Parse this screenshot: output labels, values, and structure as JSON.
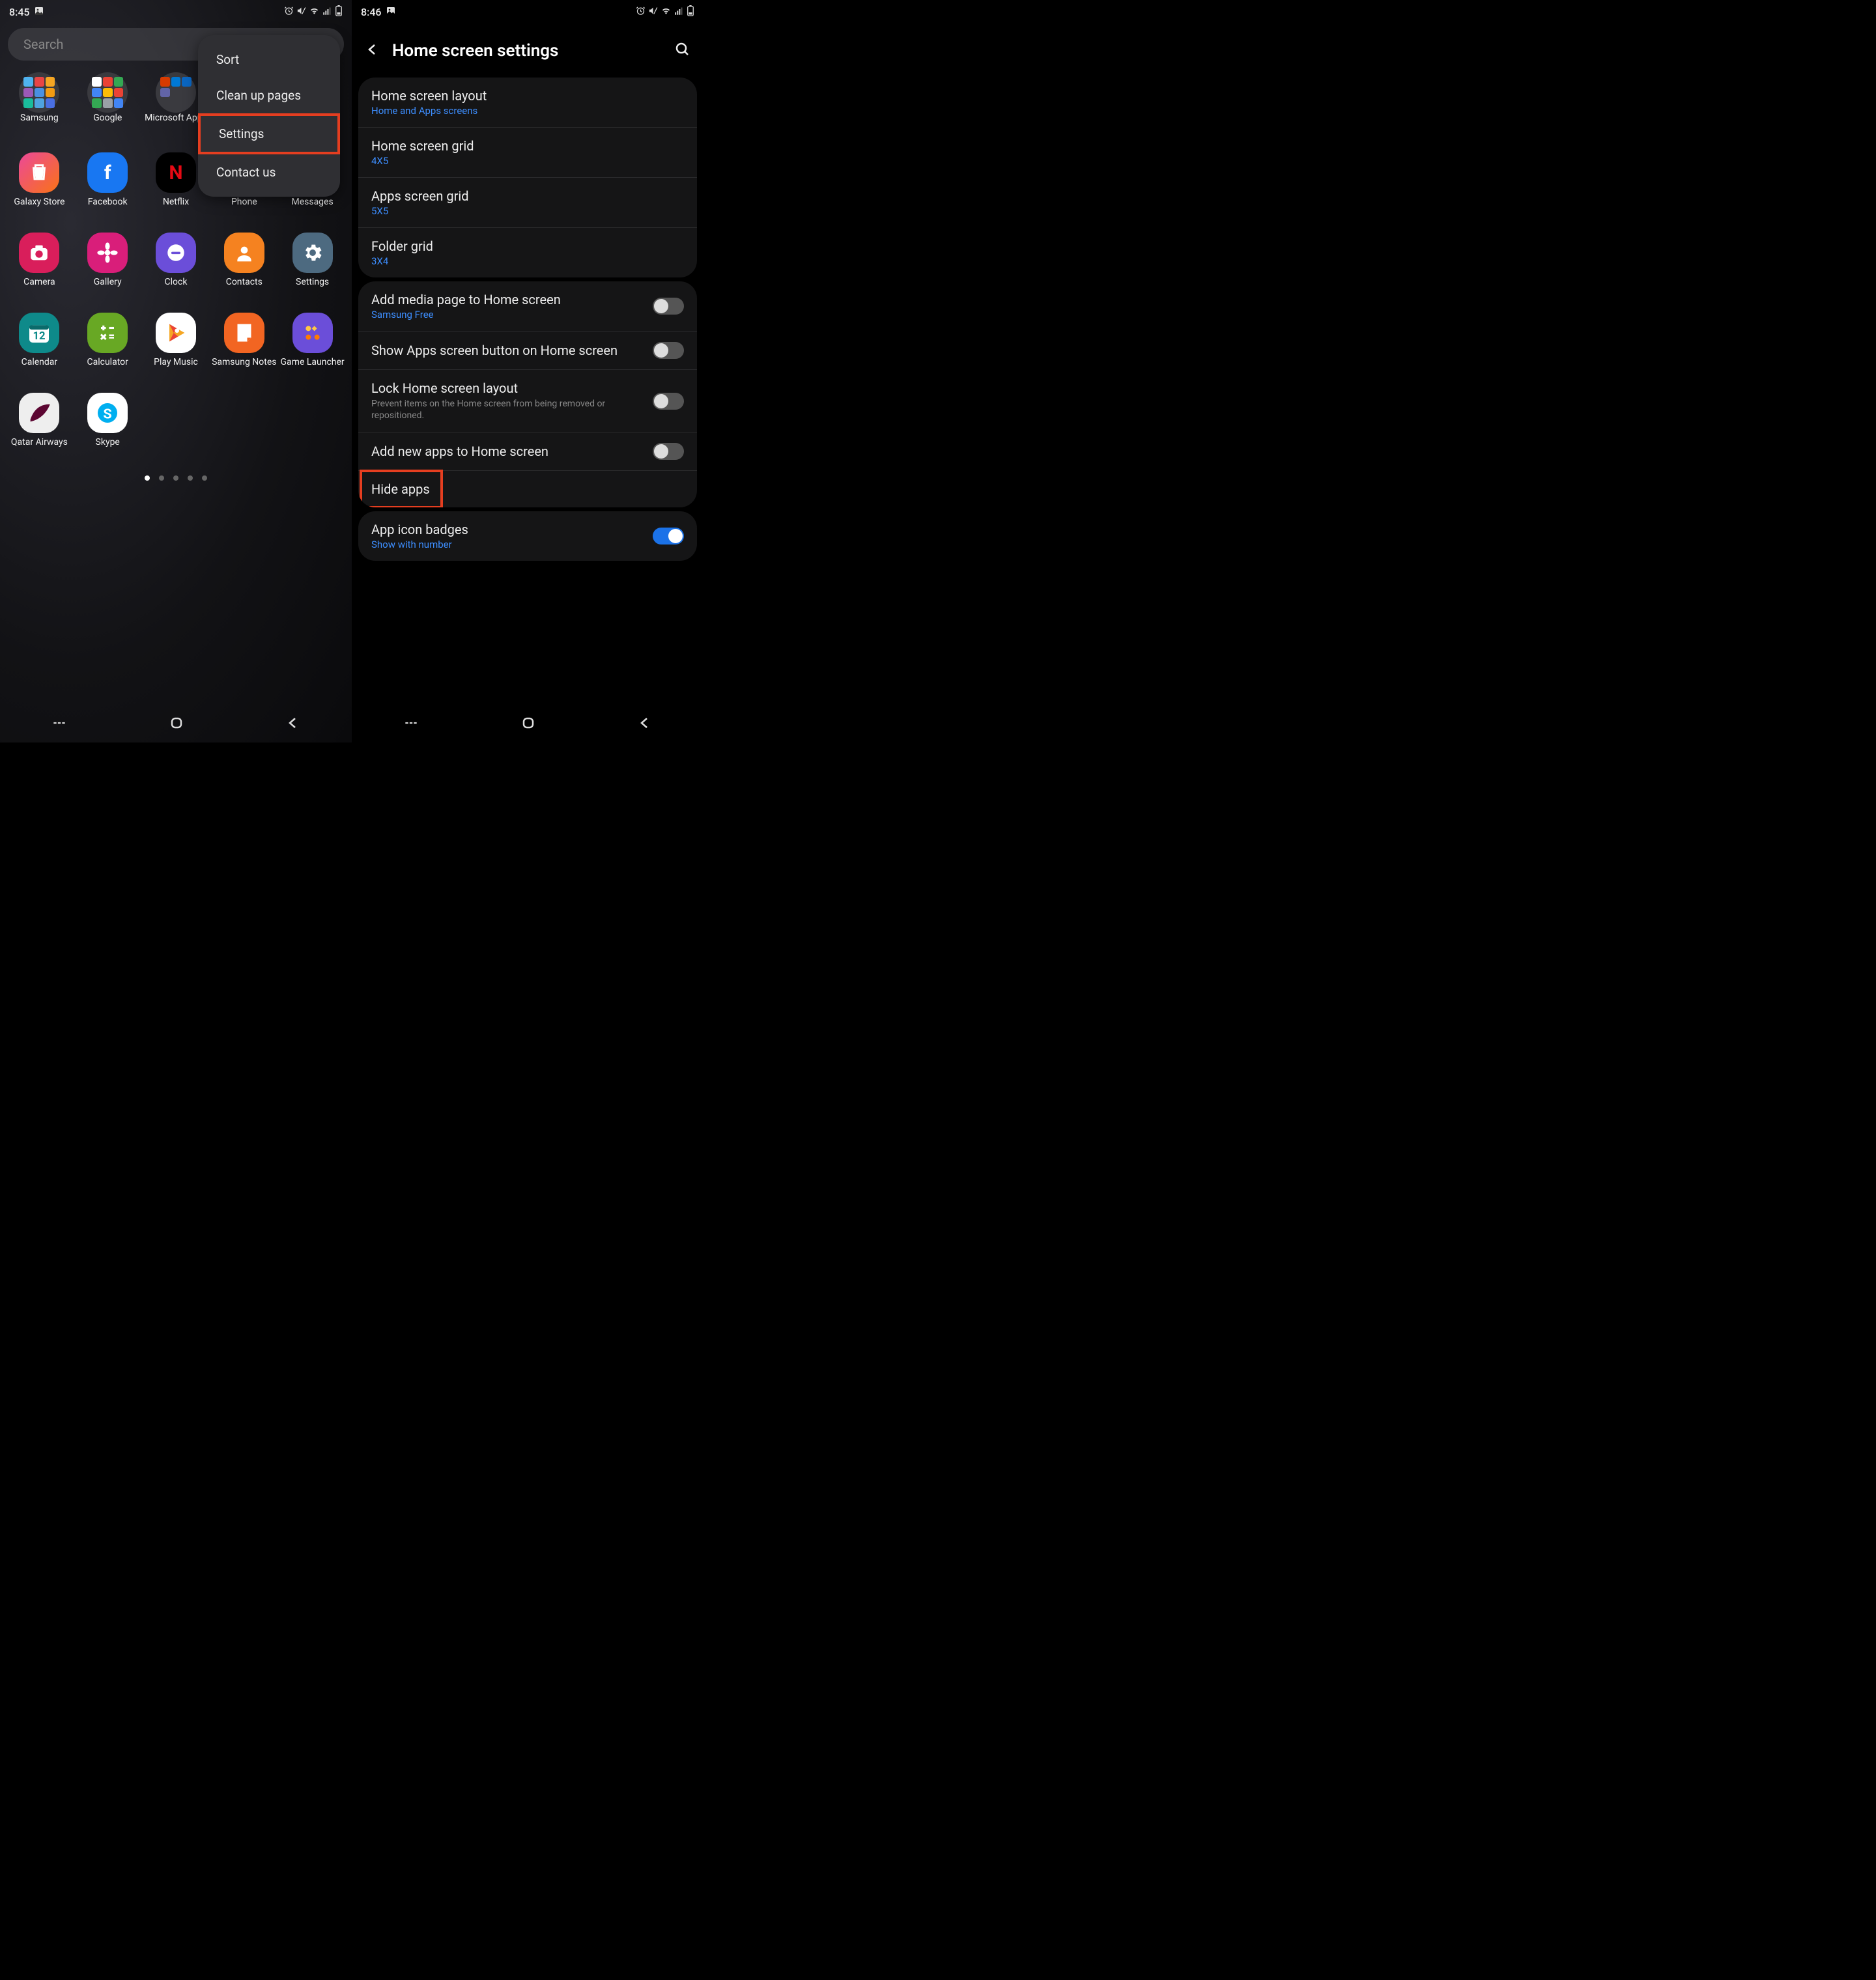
{
  "left": {
    "status_time": "8:45",
    "search_placeholder": "Search",
    "menu": {
      "sort": "Sort",
      "clean": "Clean up pages",
      "settings": "Settings",
      "contact": "Contact us"
    },
    "apps": {
      "samsung": "Samsung",
      "google": "Google",
      "microsoft": "Microsoft Apps",
      "galaxy_store": "Galaxy Store",
      "facebook": "Facebook",
      "netflix": "Netflix",
      "phone": "Phone",
      "messages": "Messages",
      "camera": "Camera",
      "gallery": "Gallery",
      "clock": "Clock",
      "contacts": "Contacts",
      "settings": "Settings",
      "calendar": "Calendar",
      "calculator": "Calculator",
      "play_music": "Play Music",
      "samsung_notes": "Samsung Notes",
      "game_launcher": "Game Launcher",
      "qatar": "Qatar Airways",
      "skype": "Skype"
    }
  },
  "right": {
    "status_time": "8:46",
    "title": "Home screen settings",
    "rows": {
      "layout_t": "Home screen layout",
      "layout_s": "Home and Apps screens",
      "hgrid_t": "Home screen grid",
      "hgrid_s": "4X5",
      "agrid_t": "Apps screen grid",
      "agrid_s": "5X5",
      "fgrid_t": "Folder grid",
      "fgrid_s": "3X4",
      "media_t": "Add media page to Home screen",
      "media_s": "Samsung Free",
      "showbtn_t": "Show Apps screen button on Home screen",
      "lock_t": "Lock Home screen layout",
      "lock_d": "Prevent items on the Home screen from being removed or repositioned.",
      "addnew_t": "Add new apps to Home screen",
      "hide_t": "Hide apps",
      "badges_t": "App icon badges",
      "badges_s": "Show with number"
    }
  }
}
